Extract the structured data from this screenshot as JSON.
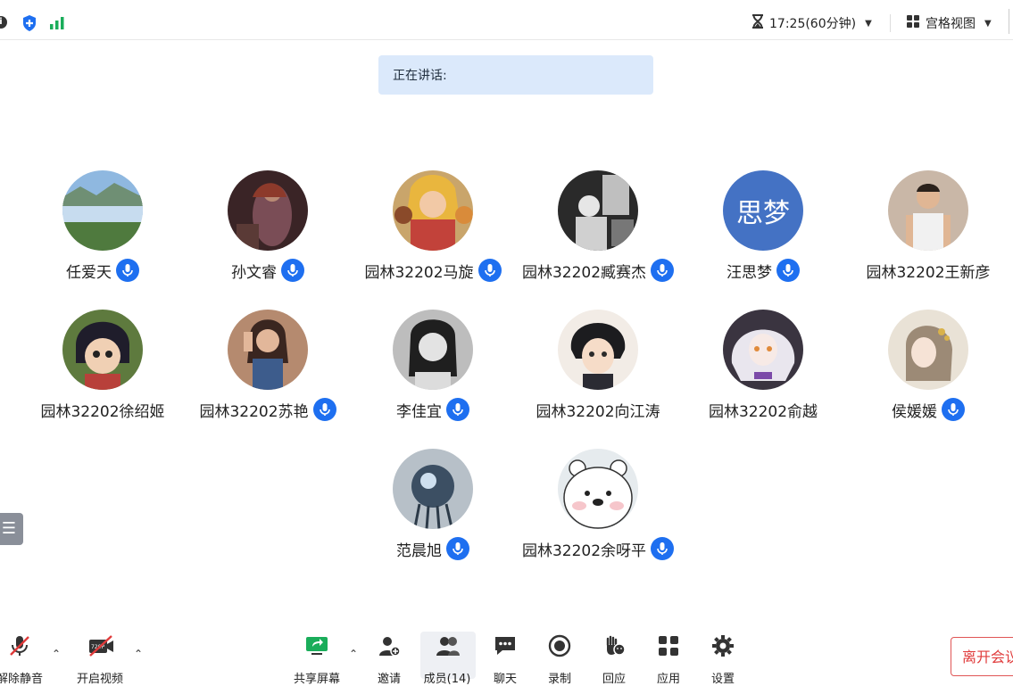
{
  "header": {
    "timer": "17:25(60分钟)",
    "view_mode": "宫格视图"
  },
  "speaking_banner": "正在讲话:",
  "participants": [
    {
      "name": "任爱天",
      "avatar": "lake-landscape-photo",
      "mic": "mic-icon"
    },
    {
      "name": "孙文睿",
      "avatar": "painting-portrait",
      "mic": "mic-icon"
    },
    {
      "name": "园林32202马旋",
      "avatar": "cartoon-girls",
      "mic": "mic-icon"
    },
    {
      "name": "园林32202臧赛杰",
      "avatar": "bw-photo",
      "mic": "mic-icon"
    },
    {
      "name": "汪思梦",
      "avatar_text": "思梦",
      "avatar_color": "#4472c4",
      "mic": "mic-icon"
    },
    {
      "name": "园林32202王新彦",
      "avatar": "person-photo",
      "mic": ""
    },
    {
      "name": "园林32202徐绍姬",
      "avatar": "anime-boy",
      "mic": ""
    },
    {
      "name": "园林32202苏艳",
      "avatar": "girl-photo",
      "mic": "mic-icon"
    },
    {
      "name": "李佳宜",
      "avatar": "girl-bw-photo",
      "mic": "mic-icon"
    },
    {
      "name": "园林32202向江涛",
      "avatar": "anime-boy-dark-hair",
      "mic": ""
    },
    {
      "name": "园林32202俞越",
      "avatar": "anime-white-hair",
      "mic": ""
    },
    {
      "name": "侯媛媛",
      "avatar": "illustrated-girl",
      "mic": "mic-icon"
    },
    {
      "name": "范晨旭",
      "avatar": "dark-sphere-art",
      "mic": "mic-icon"
    },
    {
      "name": "园林32202余呀平",
      "avatar": "cute-bear",
      "mic": "mic-icon"
    }
  ],
  "toolbar": {
    "mute": "解除静音",
    "video": "开启视频",
    "video_badge": "720P",
    "share": "共享屏幕",
    "invite": "邀请",
    "members": "成员(14)",
    "chat": "聊天",
    "record": "录制",
    "react": "回应",
    "apps": "应用",
    "settings": "设置",
    "leave": "离开会议"
  },
  "colors": {
    "mic_blue": "#1e6ff0",
    "banner_bg": "#dbe9fb",
    "leave_red": "#e03b3b",
    "share_green": "#1aad5a"
  }
}
